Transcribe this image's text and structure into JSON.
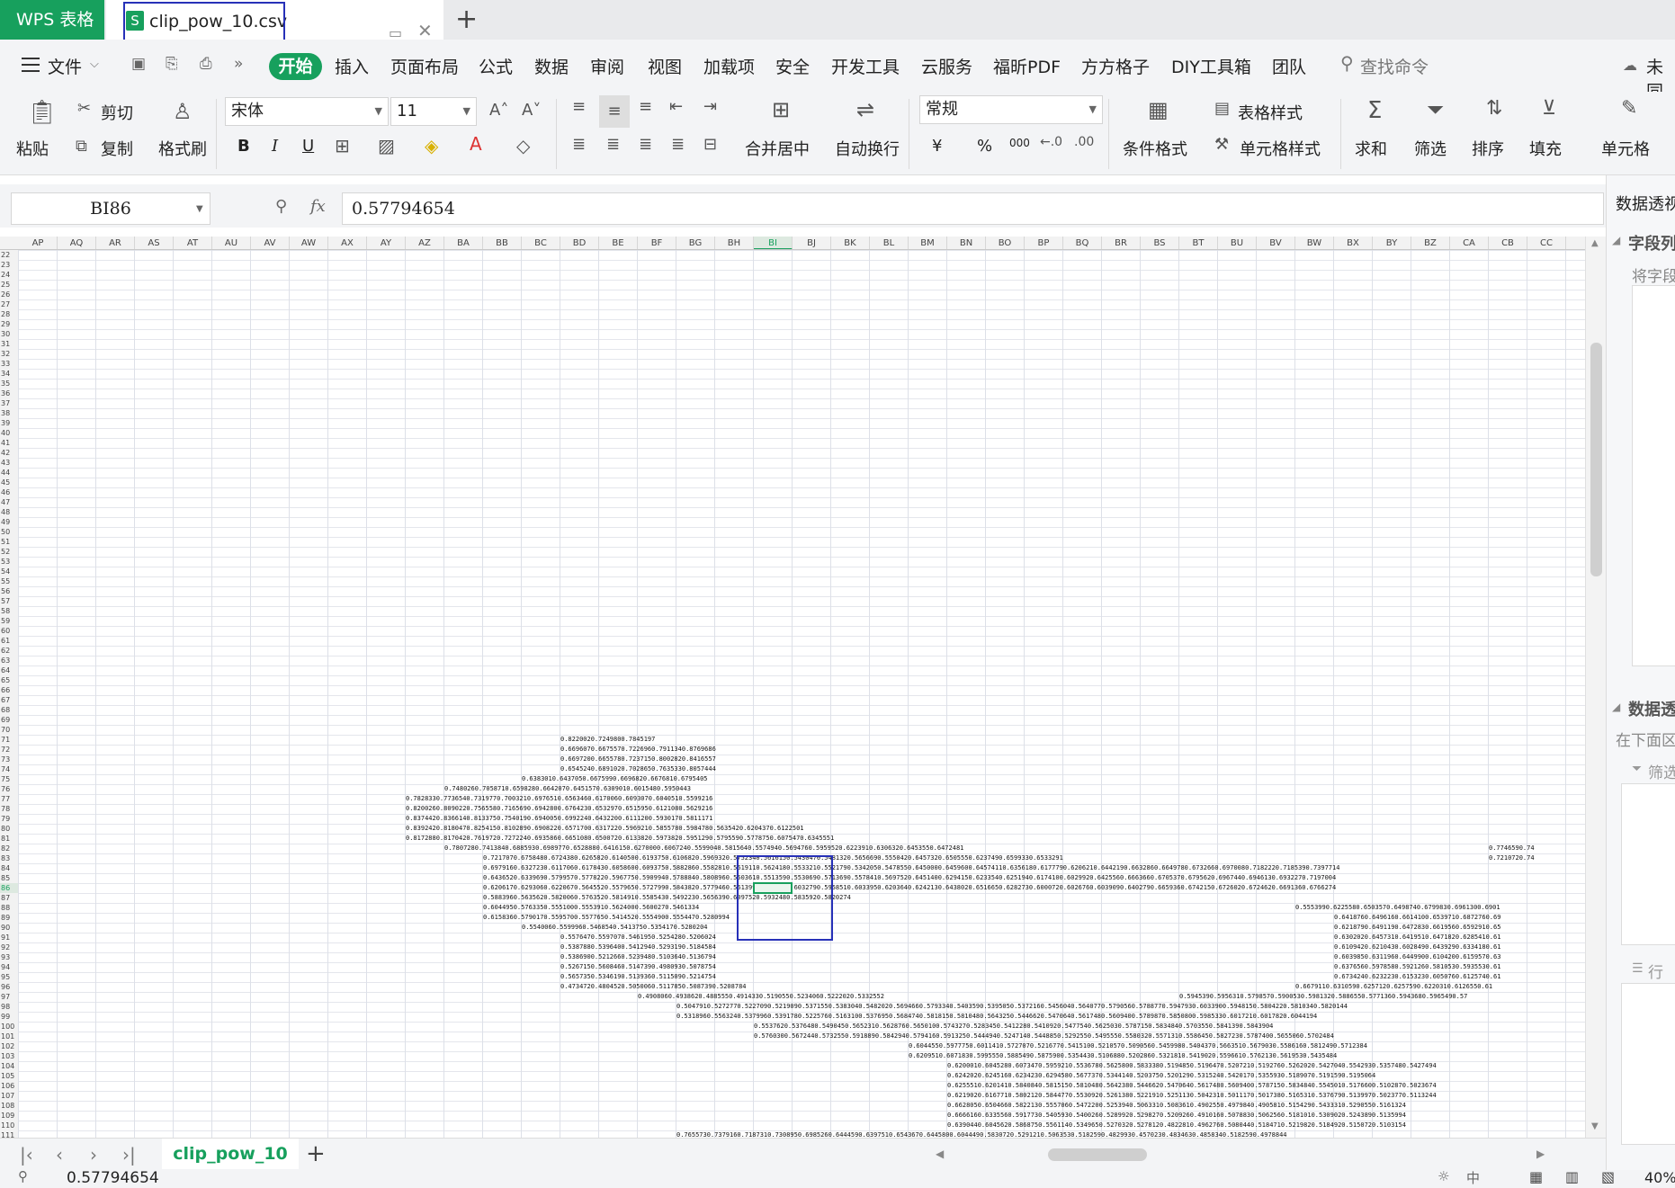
{
  "titlebar": {
    "app_tab": "WPS 表格",
    "file_name": "clip_pow_10.csv",
    "file_icon": "S",
    "new_tab": "+"
  },
  "menu": {
    "items": [
      "文件",
      "开始",
      "插入",
      "页面布局",
      "公式",
      "数据",
      "审阅",
      "视图",
      "加载项",
      "安全",
      "开发工具",
      "云服务",
      "福昕PDF",
      "方方格子",
      "DIY工具箱",
      "团队"
    ],
    "search_placeholder": "查找命令",
    "unsync": "未同"
  },
  "ribbon": {
    "paste": "粘贴",
    "cut": "剪切",
    "copy": "复制",
    "format_painter": "格式刷",
    "font_name": "宋体",
    "font_size": "11",
    "bold": "B",
    "italic": "I",
    "underline": "U",
    "merge_center": "合并居中",
    "wrap": "自动换行",
    "number_format": "常规",
    "currency": "¥",
    "percent": "%",
    "thousands": "000",
    "cond_format": "条件格式",
    "table_style": "表格样式",
    "cell_style": "单元格样式",
    "sum": "求和",
    "filter": "筛选",
    "sort": "排序",
    "fill": "填充",
    "cells": "单元格"
  },
  "formula_bar": {
    "name_box": "BI86",
    "fx": "fx",
    "value": "0.57794654"
  },
  "grid": {
    "columns": [
      "AP",
      "AQ",
      "AR",
      "AS",
      "AT",
      "AU",
      "AV",
      "AW",
      "AX",
      "AY",
      "AZ",
      "BA",
      "BB",
      "BC",
      "BD",
      "BE",
      "BF",
      "BG",
      "BH",
      "BI",
      "BJ",
      "BK",
      "BL",
      "BM",
      "BN",
      "BO",
      "BP",
      "BQ",
      "BR",
      "BS",
      "BT",
      "BU",
      "BV",
      "BW",
      "BX",
      "BY",
      "BZ",
      "CA",
      "CB",
      "CC"
    ],
    "selected_column": "BI",
    "first_row": 22,
    "last_row": 111,
    "selected_row": 86,
    "cells": [
      {
        "r": 71,
        "c": 14,
        "v": "0.8220020.7249800.7845197"
      },
      {
        "r": 72,
        "c": 14,
        "v": "0.6696070.6675570.7226960.7911340.8769686"
      },
      {
        "r": 73,
        "c": 14,
        "v": "0.6697200.6655780.7237150.8002820.8416557"
      },
      {
        "r": 74,
        "c": 14,
        "v": "0.6545240.6891020.7028650.7635330.8057444"
      },
      {
        "r": 75,
        "c": 13,
        "v": "0.6383010.6437050.6675990.6696820.6676810.6795405"
      },
      {
        "r": 76,
        "c": 11,
        "v": "0.7480260.7058710.6598280.6642070.6451570.6309010.6015480.5950443"
      },
      {
        "r": 77,
        "c": 10,
        "v": "0.7828330.7736540.7319770.7003210.6976510.6563460.6170060.6093070.6040510.5599216"
      },
      {
        "r": 78,
        "c": 10,
        "v": "0.8200260.8090220.7565580.7165690.6942800.6764230.6532970.6515950.6121080.5629216"
      },
      {
        "r": 79,
        "c": 10,
        "v": "0.8374420.8366140.8133750.7540190.6940050.6992240.6432200.6111200.5930170.5811171"
      },
      {
        "r": 80,
        "c": 10,
        "v": "0.8392420.8180470.8254150.8102890.6908220.6571700.6317220.5969210.5855780.5984780.5635420.6204370.6122501"
      },
      {
        "r": 81,
        "c": 10,
        "v": "0.8172880.8170420.7619720.7272240.6935860.6651080.6500720.6133820.5973820.5951290.5795590.5778750.6075470.6345551"
      },
      {
        "r": 82,
        "c": 11,
        "v": "0.7807280.7413840.6885930.6989770.6528880.6416150.6270000.6067240.5599040.5815640.5574940.5694760.5959520.6223910.6306320.6453550.6472481"
      },
      {
        "r": 83,
        "c": 12,
        "v": "0.7217070.6758480.6724380.6265820.6140500.6193750.6106820.5969320.5752340.5616150.5430470.5481320.5656690.5550420.6457320.6505550.6237490.6599330.6533291"
      },
      {
        "r": 84,
        "c": 12,
        "v": "0.6979160.6327230.6117060.6178430.6058600.6093750.5882860.5582810.5619110.5624180.5533210.5521790.5342050.5478550.6450000.6459600.64574110.6356180.6177790.6206210.6442190.6632860.6649780.6732660.6970080.7182220.7185390.7397714"
      },
      {
        "r": 85,
        "c": 12,
        "v": "0.6436520.6339690.5799570.5778220.5967750.5909940.5788840.5808960.5503610.5513590.5530690.5713690.5578410.5697520.6451400.6294150.6233540.6251940.6174100.6029920.6425560.6663660.6705370.6795620.6967440.6946130.6932270.7197004"
      },
      {
        "r": 86,
        "c": 12,
        "v": "0.6206170.6293060.6220670.5645520.5579650.5727990.5843820.5779460.5613990.5963420.6032790.5958510.6033950.6203640.6242130.6438020.6516650.6282730.6000720.6026760.6039090.6402790.6659360.6742150.6726020.6724620.6691360.6766274"
      },
      {
        "r": 87,
        "c": 12,
        "v": "0.5883960.5635620.5820060.5763520.5814910.5585430.5492230.5656390.6097520.5932480.5835920.5820274"
      },
      {
        "r": 88,
        "c": 12,
        "v": "0.6044950.5763350.5551000.5553910.5624000.5600270.5461334"
      },
      {
        "r": 89,
        "c": 12,
        "v": "0.6158360.5790170.5595700.5577650.5414520.5554900.5554470.5280994"
      },
      {
        "r": 90,
        "c": 13,
        "v": "0.5540060.5599960.5468540.5413750.5354170.5280204"
      },
      {
        "r": 91,
        "c": 14,
        "v": "0.5576470.5597070.5461950.5254280.5206024"
      },
      {
        "r": 92,
        "c": 14,
        "v": "0.5387880.5396400.5412940.5293190.5184584"
      },
      {
        "r": 93,
        "c": 14,
        "v": "0.5386900.5212660.5239480.5103640.5136794"
      },
      {
        "r": 94,
        "c": 14,
        "v": "0.5267150.5608460.5147390.4980930.5078754"
      },
      {
        "r": 95,
        "c": 14,
        "v": "0.5657350.5346190.5139360.5115090.5214754"
      },
      {
        "r": 96,
        "c": 14,
        "v": "0.4734720.4804520.5050060.5117850.5087390.5208784"
      },
      {
        "r": 97,
        "c": 16,
        "v": "0.4908060.4938620.4885550.4914330.5190550.5234060.5222020.5332552"
      },
      {
        "r": 98,
        "c": 17,
        "v": "0.5047910.5272770.5227090.5219090.5371550.5383040.5482020.5694660.5793340.5403590.5395050.5372160.5456040.5640770.5790560.5788770.5947930.6033900.5948150.5804220.5810340.5820144"
      },
      {
        "r": 99,
        "c": 17,
        "v": "0.5318960.5563240.5379960.5391780.5225760.5163100.5376950.5684740.5818150.5810480.5643250.5446620.5470640.5617480.5609400.5789870.5850800.5985330.6017210.6017820.6044194"
      },
      {
        "r": 100,
        "c": 19,
        "v": "0.5537620.5376480.5490450.5652310.5628760.5650100.5743270.5283450.5412280.5410920.5477540.5625030.5787150.5834840.5703550.5841390.5843904"
      },
      {
        "r": 101,
        "c": 19,
        "v": "0.5760300.5672440.5732550.5918890.5842940.5794160.5913250.5444940.5247140.5448850.5292550.5495550.5580320.5571310.5586450.5827230.5787400.5655060.5702484"
      },
      {
        "r": 102,
        "c": 23,
        "v": "0.6044550.5977750.6011410.5727070.5216770.5415100.5210570.5090560.5459980.5404370.5663510.5679030.5586160.5812490.5712384"
      },
      {
        "r": 103,
        "c": 23,
        "v": "0.6209510.6071830.5995550.5885490.5875900.5354430.5106880.5202860.5321810.5419020.5596610.5762130.5619530.5435484"
      },
      {
        "r": 104,
        "c": 24,
        "v": "0.6200010.6045280.6073470.5959210.5536780.5625800.5833380.5194850.5196470.5207210.5192760.5262020.5427040.5542930.5357480.5427494"
      },
      {
        "r": 105,
        "c": 24,
        "v": "0.6242020.6245160.6234230.6294580.5677370.5344140.5203750.5201290.5315240.5420170.5355930.5189070.5191590.5195064"
      },
      {
        "r": 106,
        "c": 24,
        "v": "0.6255510.6201410.5840840.5815150.5810480.5642380.5446620.5470640.5617480.5609400.5787150.5834840.5545010.5176600.5102870.5023674"
      },
      {
        "r": 107,
        "c": 24,
        "v": "0.6219020.6167710.5802120.5844770.5530920.5261380.5221910.5251130.5042310.5011170.5017380.5165310.5376790.5139970.5023770.5113244"
      },
      {
        "r": 108,
        "c": 24,
        "v": "0.6628050.6504660.5822130.5557060.5472200.5253940.5063310.5083610.4902550.4979840.4905810.5154290.5433310.5290550.5161324"
      },
      {
        "r": 109,
        "c": 24,
        "v": "0.6666160.6335560.5917730.5405930.5400260.5289920.5298270.5209260.4910160.5078830.5062560.5181010.5309020.5243890.5135994"
      },
      {
        "r": 110,
        "c": 24,
        "v": "0.6390440.6045620.5868750.5561140.5349650.5270320.5278120.4822810.4962760.5080440.5184710.5219820.5184920.5150720.5103154"
      },
      {
        "r": 111,
        "c": 17,
        "v": "0.7655730.7379160.7187310.7308950.6985260.6444590.6397510.6543670.6445800.6044490.5830720.5291210.5063530.5182590.4829930.4570230.4834630.4858340.5182590.4978844"
      },
      {
        "r": 82,
        "c": 38,
        "v": "0.7746590.74"
      },
      {
        "r": 83,
        "c": 38,
        "v": "0.7210720.74"
      },
      {
        "r": 88,
        "c": 33,
        "v": "0.5553990.6225580.6503570.6498740.6799830.6961300.6901"
      },
      {
        "r": 89,
        "c": 34,
        "v": "0.6418760.6496160.6614100.6539710.6872760.69"
      },
      {
        "r": 90,
        "c": 34,
        "v": "0.6218790.6491190.6472830.6619560.6592910.65"
      },
      {
        "r": 91,
        "c": 34,
        "v": "0.6302020.6457310.6419510.6471820.6285410.61"
      },
      {
        "r": 92,
        "c": 34,
        "v": "0.6109420.6210430.6028490.6439290.6334180.61"
      },
      {
        "r": 93,
        "c": 34,
        "v": "0.6039850.6311960.6449900.6104200.6159570.63"
      },
      {
        "r": 94,
        "c": 34,
        "v": "0.6376560.5978580.5921260.5810530.5935530.61"
      },
      {
        "r": 95,
        "c": 34,
        "v": "0.6734240.6232230.6153230.6050760.6125740.61"
      },
      {
        "r": 96,
        "c": 33,
        "v": "0.6679110.6310590.6257120.6257590.6220310.6126550.61"
      },
      {
        "r": 97,
        "c": 30,
        "v": "0.5945390.5956310.5798570.5900530.5981320.5886550.5771360.5943680.5965490.57"
      }
    ]
  },
  "right_panel": {
    "title": "数据透视",
    "fields_section": "字段列",
    "fields_hint": "将字段",
    "area_section": "数据透",
    "area_hint": "在下面区",
    "filter": "筛选",
    "rows": "行"
  },
  "sheets": {
    "active": "clip_pow_10",
    "add": "+"
  },
  "status": {
    "value": "0.57794654",
    "zoom": "40%"
  }
}
